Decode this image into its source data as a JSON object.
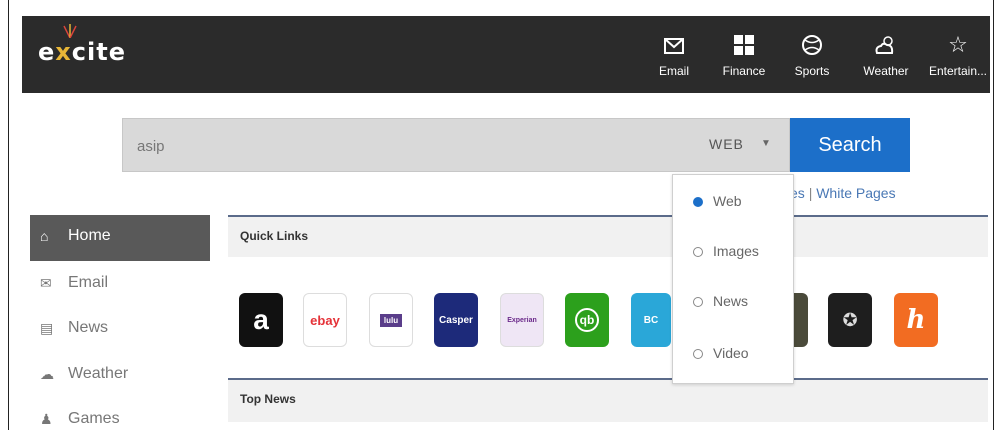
{
  "header": {
    "logo_text": "excite",
    "logo_prefix": "e",
    "logo_x": "x",
    "logo_suffix": "cite",
    "nav": [
      {
        "label": "Email",
        "icon": "envelope-icon"
      },
      {
        "label": "Finance",
        "icon": "grid-icon"
      },
      {
        "label": "Sports",
        "icon": "ball-icon"
      },
      {
        "label": "Weather",
        "icon": "cloud-sun-icon"
      },
      {
        "label": "Entertain...",
        "icon": "star-icon"
      }
    ]
  },
  "search": {
    "value": "asip",
    "type_label": "WEB",
    "button_label": "Search",
    "extra_links": {
      "partial": "es",
      "separator": "|",
      "white_pages": "White Pages"
    }
  },
  "dropdown": {
    "options": [
      {
        "label": "Web",
        "selected": true
      },
      {
        "label": "Images",
        "selected": false
      },
      {
        "label": "News",
        "selected": false
      },
      {
        "label": "Video",
        "selected": false
      }
    ]
  },
  "sidebar": {
    "items": [
      {
        "label": "Home",
        "icon": "home-icon",
        "active": true
      },
      {
        "label": "Email",
        "icon": "envelope-icon",
        "active": false
      },
      {
        "label": "News",
        "icon": "newspaper-icon",
        "active": false
      },
      {
        "label": "Weather",
        "icon": "cloud-icon",
        "active": false
      },
      {
        "label": "Games",
        "icon": "pawn-icon",
        "active": false
      }
    ]
  },
  "quick_links": {
    "title": "Quick Links",
    "tiles": [
      {
        "name": "amazon",
        "glyph": "a"
      },
      {
        "name": "ebay",
        "glyph": "ebay"
      },
      {
        "name": "hulu-like",
        "glyph": "lulu"
      },
      {
        "name": "casper",
        "glyph": "Casper"
      },
      {
        "name": "experian",
        "glyph": "Experian"
      },
      {
        "name": "quickbooks",
        "glyph": "qb"
      },
      {
        "name": "blue-cross",
        "glyph": "BC"
      },
      {
        "name": "dark-tile",
        "glyph": ""
      },
      {
        "name": "mercedes",
        "glyph": "✪"
      },
      {
        "name": "honey",
        "glyph": "h"
      }
    ]
  },
  "top_news": {
    "title": "Top News"
  },
  "colors": {
    "header_bg": "#2b2b2b",
    "accent_blue": "#1c6fc9",
    "sidebar_active": "#595959",
    "logo_x": "#e8b637"
  }
}
